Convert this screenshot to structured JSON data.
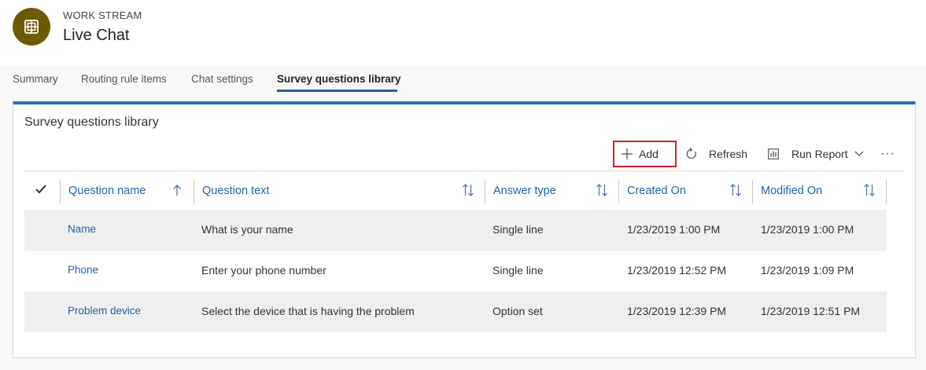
{
  "header": {
    "entity_type": "WORK STREAM",
    "entity_name": "Live Chat",
    "icon_color": "#6b5a06"
  },
  "tabs": [
    {
      "label": "Summary",
      "active": false
    },
    {
      "label": "Routing rule items",
      "active": false
    },
    {
      "label": "Chat settings",
      "active": false
    },
    {
      "label": "Survey questions library",
      "active": true
    }
  ],
  "panel": {
    "title": "Survey questions library",
    "accent_color": "#2f6fb0"
  },
  "toolbar": {
    "add_label": "Add",
    "refresh_label": "Refresh",
    "run_report_label": "Run Report",
    "more_label": "···",
    "highlight_color": "#d4212a"
  },
  "grid": {
    "columns": [
      {
        "label": "Question name",
        "sort": "ascending"
      },
      {
        "label": "Question text",
        "sort": "none"
      },
      {
        "label": "Answer type",
        "sort": "none"
      },
      {
        "label": "Created On",
        "sort": "none"
      },
      {
        "label": "Modified On",
        "sort": "none"
      }
    ],
    "rows": [
      {
        "name": "Name",
        "text": "What is your name",
        "answer_type": "Single line",
        "created_on": "1/23/2019 1:00 PM",
        "modified_on": "1/23/2019 1:00 PM"
      },
      {
        "name": "Phone",
        "text": "Enter your phone number",
        "answer_type": "Single line",
        "created_on": "1/23/2019 12:52 PM",
        "modified_on": "1/23/2019 1:09 PM"
      },
      {
        "name": "Problem device",
        "text": "Select the device that is having the problem",
        "answer_type": "Option set",
        "created_on": "1/23/2019 12:39 PM",
        "modified_on": "1/23/2019 12:51 PM"
      }
    ]
  }
}
